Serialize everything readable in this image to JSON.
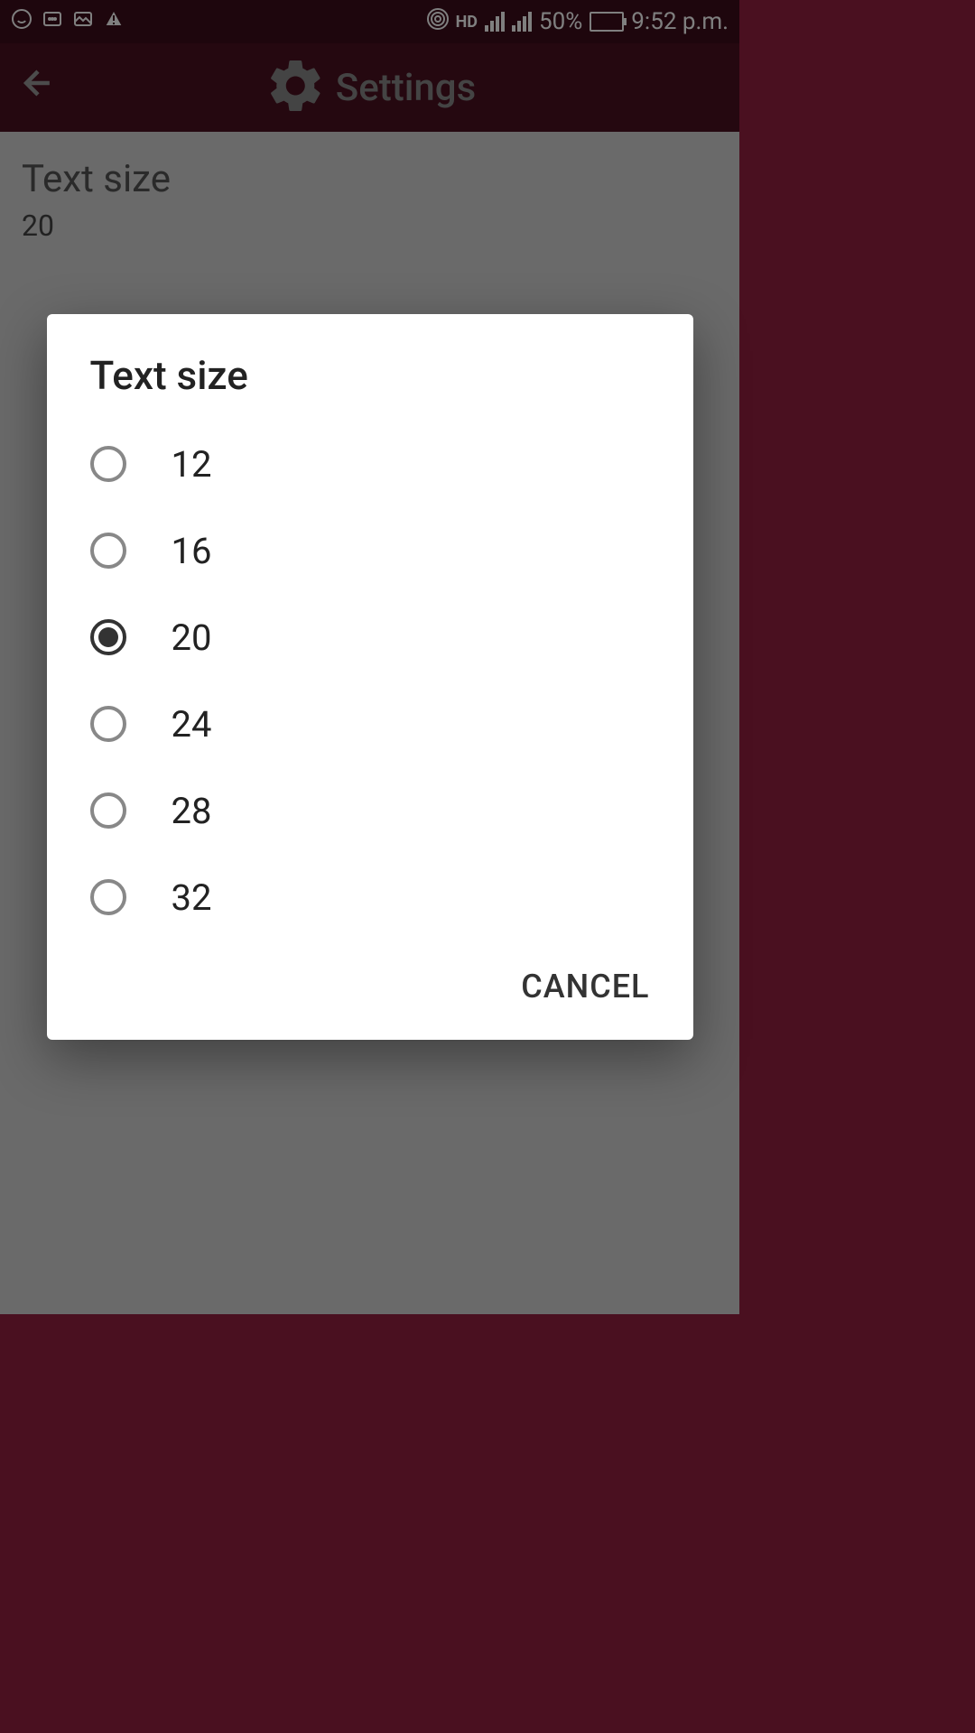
{
  "status_bar": {
    "time": "9:52 p.m.",
    "battery": "50%",
    "hd_label": "HD"
  },
  "app_bar": {
    "title": "Settings"
  },
  "setting": {
    "label": "Text size",
    "value": "20"
  },
  "dialog": {
    "title": "Text size",
    "options": [
      {
        "label": "12",
        "selected": false
      },
      {
        "label": "16",
        "selected": false
      },
      {
        "label": "20",
        "selected": true
      },
      {
        "label": "24",
        "selected": false
      },
      {
        "label": "28",
        "selected": false
      },
      {
        "label": "32",
        "selected": false
      }
    ],
    "cancel_label": "CANCEL"
  }
}
